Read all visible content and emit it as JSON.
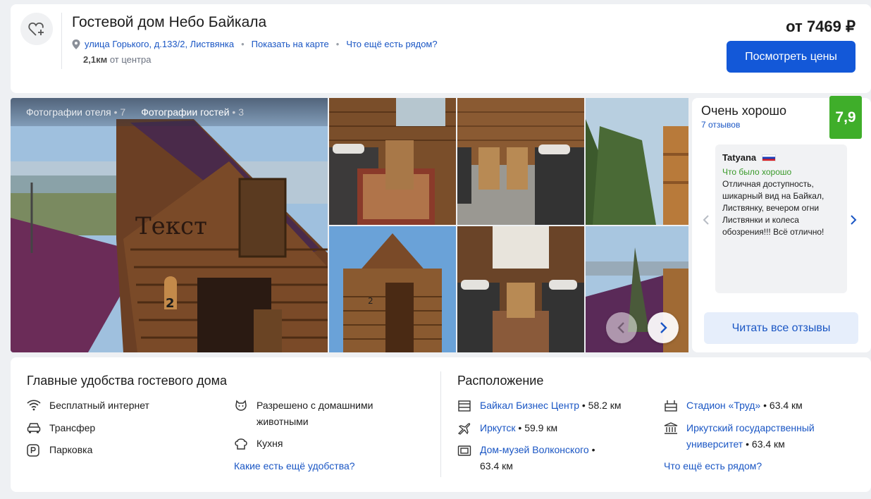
{
  "header": {
    "title": "Гостевой дом Небо Байкала",
    "address": "улица Горького, д.133/2, Листвянка",
    "show_on_map": "Показать на карте",
    "whats_nearby": "Что ещё есть рядом?",
    "distance_value": "2,1км",
    "distance_suffix": "от центра",
    "price_prefix": "от",
    "price_value": "7469 ₽",
    "cta_label": "Посмотреть цены"
  },
  "gallery": {
    "tabs": [
      {
        "label": "Фотографии отеля",
        "count": "7"
      },
      {
        "label": "Фотографии гостей",
        "count": "3"
      }
    ],
    "overlay_text": "Текст"
  },
  "rating": {
    "label": "Очень хорошо",
    "reviews": "7 отзывов",
    "score": "7,9",
    "review": {
      "author": "Tatyana",
      "good_label": "Что было хорошо",
      "text": "Отличная доступность, шикарный вид на Байкал, Листвянку, вечером огни Листвянки и колеса обозрения!!! Всё отлично!"
    },
    "read_all": "Читать все отзывы"
  },
  "amenities": {
    "title": "Главные удобства гостевого дома",
    "items": [
      {
        "label": "Бесплатный интернет",
        "icon": "wifi-icon"
      },
      {
        "label": "Трансфер",
        "icon": "car-icon"
      },
      {
        "label": "Парковка",
        "icon": "parking-icon"
      },
      {
        "label": "Разрешено с домашними животными",
        "icon": "pet-icon"
      },
      {
        "label": "Кухня",
        "icon": "chef-hat-icon"
      }
    ],
    "more": "Какие есть ещё удобства?"
  },
  "location": {
    "title": "Расположение",
    "items": [
      {
        "name": "Байкал Бизнес Центр",
        "dist": "58.2 км",
        "icon": "business-center-icon"
      },
      {
        "name": "Иркутск",
        "dist": "59.9 км",
        "icon": "airplane-icon"
      },
      {
        "name": "Дом-музей Волконского",
        "dist": "63.4 км",
        "icon": "museum-icon"
      },
      {
        "name": "Стадион «Труд»",
        "dist": "63.4 км",
        "icon": "stadium-icon"
      },
      {
        "name": "Иркутский государственный университет",
        "dist": "63.4 км",
        "icon": "university-icon"
      }
    ],
    "more": "Что ещё есть рядом?"
  }
}
